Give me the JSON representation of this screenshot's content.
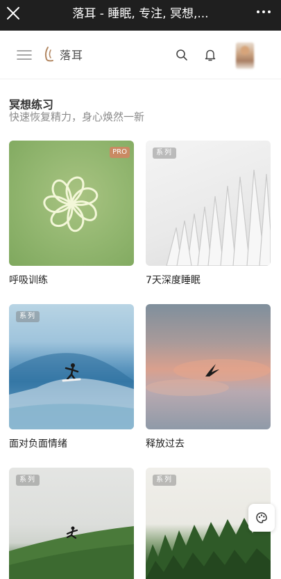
{
  "window": {
    "title": "落耳 - 睡眠, 专注, 冥想,...",
    "close_icon": "close-icon",
    "more_icon": "more-dots-icon"
  },
  "header": {
    "logo_text": "落耳",
    "icons": [
      "menu-icon",
      "logo-icon",
      "search-icon",
      "bell-icon",
      "avatar"
    ]
  },
  "section": {
    "title": "冥想练习",
    "subtitle": "快速恢复精力，身心焕然一新"
  },
  "cards": [
    {
      "label": "呼吸训练",
      "badge": "PRO"
    },
    {
      "label": "7天深度睡眠",
      "badge": "系列"
    },
    {
      "label": "面对负面情绪",
      "badge": "系列"
    },
    {
      "label": "释放过去",
      "badge": "系列"
    },
    {
      "label": "",
      "badge": "系列"
    },
    {
      "label": "",
      "badge": "系列"
    }
  ],
  "float_button": {
    "icon": "palette-icon"
  },
  "colors": {
    "topbar": "#1f1f1f",
    "pro_badge": "#c98a63",
    "subtitle": "#8a8a8a"
  }
}
